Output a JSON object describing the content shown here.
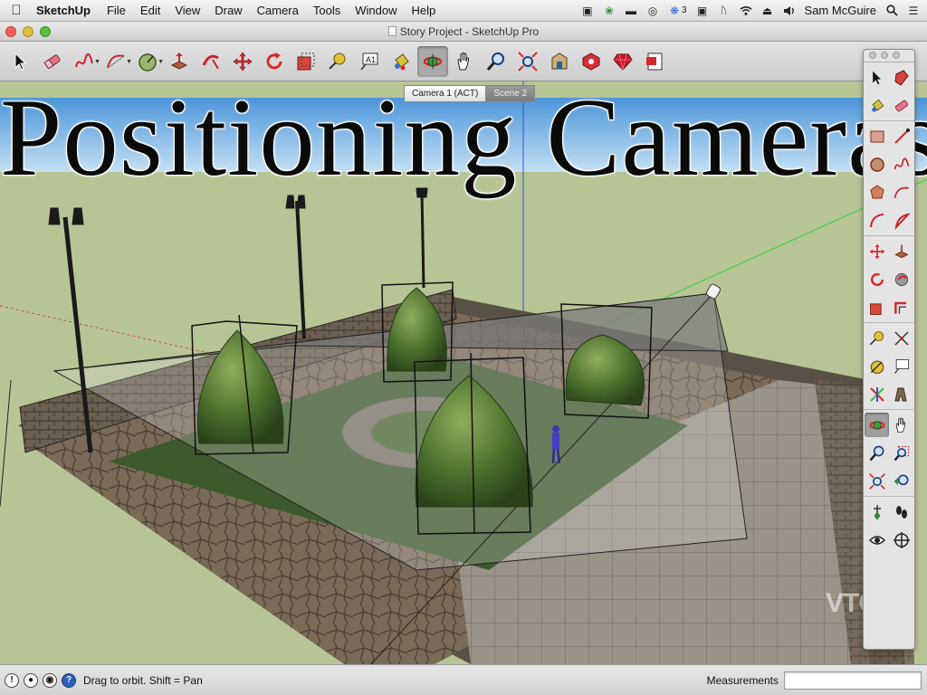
{
  "menubar": {
    "app_name": "SketchUp",
    "items": [
      "File",
      "Edit",
      "View",
      "Draw",
      "Camera",
      "Tools",
      "Window",
      "Help"
    ],
    "status_icons": [
      "facetime-icon",
      "flower-icon",
      "minus-icon",
      "target-icon",
      "cloud-sync-icon",
      "screen-icon",
      "bluetooth-icon",
      "wifi-icon",
      "eject-icon",
      "volume-icon",
      "search-icon",
      "list-icon"
    ],
    "badge_count": "3",
    "user_name": "Sam McGuire"
  },
  "window": {
    "title": "Story Project - SketchUp Pro",
    "traffic_lights": {
      "close": "#fc5b57",
      "minimize": "#e5bf3c",
      "zoom": "#57c038"
    }
  },
  "toolbar": {
    "buttons": [
      {
        "icon": "select-arrow-icon"
      },
      {
        "icon": "eraser-icon"
      },
      {
        "icon": "freehand-icon",
        "dropdown": true
      },
      {
        "icon": "arc-icon",
        "dropdown": true
      },
      {
        "icon": "protractor-icon",
        "dropdown": true
      },
      {
        "icon": "push-pull-icon"
      },
      {
        "icon": "follow-me-icon"
      },
      {
        "icon": "move-icon"
      },
      {
        "icon": "rotate-icon"
      },
      {
        "icon": "scale-icon"
      },
      {
        "icon": "tape-measure-icon"
      },
      {
        "icon": "text-icon"
      },
      {
        "icon": "paint-bucket-icon"
      },
      {
        "icon": "orbit-icon",
        "active": true
      },
      {
        "icon": "pan-icon"
      },
      {
        "icon": "zoom-icon"
      },
      {
        "icon": "zoom-extents-icon"
      },
      {
        "icon": "warehouse-icon"
      },
      {
        "icon": "extension-warehouse-icon"
      },
      {
        "icon": "ruby-icon"
      },
      {
        "icon": "layout-icon"
      }
    ]
  },
  "scene_tabs": [
    "Camera 1 (ACT)",
    "Scene 2"
  ],
  "overlay_title": "Positioning Cameras",
  "watermark": "VTC",
  "palette": {
    "groups": [
      [
        "select-arrow-icon",
        "make-component-icon",
        "paint-bucket-icon",
        "eraser-icon"
      ],
      [
        "rectangle-icon",
        "line-icon",
        "circle-icon",
        "freehand-icon",
        "polygon-icon",
        "arc-icon",
        "two-point-arc-icon",
        "pie-icon"
      ],
      [
        "move-icon",
        "push-pull-icon",
        "rotate-icon",
        "follow-me-icon",
        "scale-icon",
        "offset-icon"
      ],
      [
        "tape-measure-icon",
        "dimension-icon",
        "protractor-icon",
        "text-icon",
        "axes-icon",
        "3d-text-icon"
      ],
      [
        "orbit-icon",
        "pan-icon",
        "zoom-icon",
        "zoom-window-icon",
        "zoom-extents-icon",
        "previous-view-icon"
      ],
      [
        "position-camera-icon",
        "walk-icon",
        "look-around-icon",
        "section-plane-icon"
      ]
    ],
    "active": "orbit-icon"
  },
  "statusbar": {
    "icons": [
      "info-icon",
      "user-icon",
      "geo-icon",
      "help-icon"
    ],
    "text": "Drag to orbit.  Shift = Pan",
    "measurements_label": "Measurements",
    "measurements_value": ""
  },
  "colors": {
    "sky_top": "#4c95d9",
    "sky_bottom": "#c3e0f4",
    "ground": "#b7c596",
    "axis_green": "#3fd33f",
    "axis_red": "#d24a4a",
    "axis_blue": "#3a4fd6"
  }
}
